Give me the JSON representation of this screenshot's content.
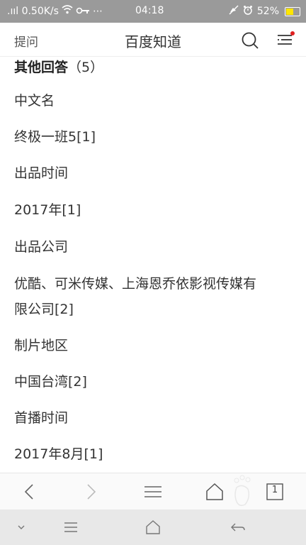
{
  "status_bar": {
    "network_speed": ".ııl 0.50K/s",
    "extras": "⋯",
    "time": "04:18",
    "battery": "52%"
  },
  "header": {
    "ask_label": "提问",
    "title": "百度知道"
  },
  "content": {
    "section_title": "其他回答",
    "section_count": "（5）",
    "lines": [
      "中文名",
      "终极一班5[1]",
      "出品时间",
      "2017年[1]",
      "出品公司",
      "优酷、可米传媒、上海恩乔依影视传媒有",
      "限公司[2]",
      "制片地区",
      "中国台湾[2]",
      "首播时间",
      "2017年8月[1]"
    ]
  },
  "browser_bar": {
    "tab_count": "1"
  },
  "colors": {
    "status_bg": "#9a9a9a",
    "nav_bg": "#e8e8e8",
    "notification_dot": "#e02020"
  }
}
